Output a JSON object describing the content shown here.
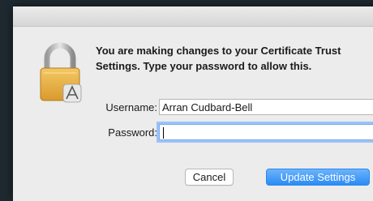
{
  "dialog": {
    "message": "You are making changes to your Certificate Trust Settings. Type your password to allow this.",
    "username_label": "Username:",
    "username_value": "Arran Cudbard-Bell",
    "password_label": "Password:",
    "password_value": "",
    "cancel_label": "Cancel",
    "confirm_label": "Update Settings"
  },
  "colors": {
    "primary_button": "#2a8cf6",
    "focus_ring": "#9cc3f7",
    "background": "#1f2a30"
  },
  "icons": {
    "lock": "lock-icon",
    "badge": "app-badge-icon"
  }
}
